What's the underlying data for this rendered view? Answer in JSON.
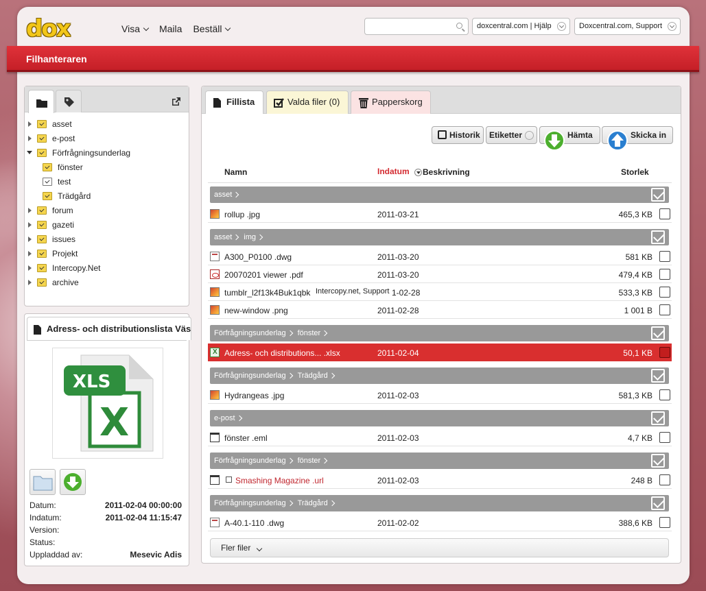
{
  "logo": "dox",
  "nav": {
    "visa": "Visa",
    "maila": "Maila",
    "bestall": "Beställ"
  },
  "search": {
    "placeholder": ""
  },
  "help_dropdown": "doxcentral.com | Hjälp",
  "account_dropdown": "Doxcentral.com, Support",
  "page_title": "Filhanteraren",
  "tree": [
    {
      "label": "asset",
      "level": 0,
      "expanded": false
    },
    {
      "label": "e-post",
      "level": 0,
      "expanded": false
    },
    {
      "label": "Förfrågningsunderlag",
      "level": 0,
      "expanded": true
    },
    {
      "label": "fönster",
      "level": 1
    },
    {
      "label": "test",
      "level": 1
    },
    {
      "label": "Trädgård",
      "level": 1
    },
    {
      "label": "forum",
      "level": 0,
      "expanded": false
    },
    {
      "label": "gazeti",
      "level": 0,
      "expanded": false
    },
    {
      "label": "issues",
      "level": 0,
      "expanded": false
    },
    {
      "label": "Projekt",
      "level": 0,
      "expanded": false
    },
    {
      "label": "Intercopy.Net",
      "level": 0,
      "expanded": false
    },
    {
      "label": "archive",
      "level": 0,
      "expanded": false
    }
  ],
  "preview": {
    "title": "Adress- och distributionslista Väst",
    "icon_text": "XLS",
    "labels": {
      "datum": "Datum:",
      "indatum": "Indatum:",
      "version": "Version:",
      "status": "Status:",
      "uppladdad": "Uppladdad av:"
    },
    "values": {
      "datum": "2011-02-04 00:00:00",
      "indatum": "2011-02-04 11:15:47",
      "version": "",
      "status": "",
      "uppladdad": "Mesevic Adis"
    }
  },
  "tabs": {
    "fillista": "Fillista",
    "valda": "Valda filer (0)",
    "papperskorg": "Papperskorg"
  },
  "buttons": {
    "historik": "Historik",
    "etiketter": "Etiketter",
    "hamta": "Hämta",
    "skicka": "Skicka in"
  },
  "columns": {
    "namn": "Namn",
    "indatum": "Indatum",
    "beskrivning": "Beskrivning",
    "storlek": "Storlek"
  },
  "groups": [
    {
      "path": [
        "asset"
      ]
    },
    {
      "path": [
        "asset",
        "img"
      ]
    },
    {
      "path": [
        "Förfrågningsunderlag",
        "fönster"
      ]
    },
    {
      "path": [
        "Förfrågningsunderlag",
        "Trädgård"
      ]
    },
    {
      "path": [
        "e-post"
      ]
    },
    {
      "path": [
        "Förfrågningsunderlag",
        "fönster"
      ]
    },
    {
      "path": [
        "Förfrågningsunderlag",
        "Trädgård"
      ]
    }
  ],
  "files": [
    {
      "name": "rollup .jpg",
      "date": "2011-03-21",
      "size": "465,3 KB",
      "icon": "image-icon"
    },
    {
      "name": "A300_P0100 .dwg",
      "date": "2011-03-20",
      "size": "581 KB",
      "icon": "drawing-icon"
    },
    {
      "name": "20070201 viewer .pdf",
      "date": "2011-03-20",
      "size": "479,4 KB",
      "icon": "pdf-icon"
    },
    {
      "name": "tumblr_l2f13k4Buk1qbk",
      "date": "1-02-28",
      "size": "533,3 KB",
      "icon": "image-icon",
      "tooltip": "Intercopy.net, Support"
    },
    {
      "name": "new-window .png",
      "date": "2011-02-28",
      "size": "1 001 B",
      "icon": "image-icon"
    },
    {
      "name": "Adress- och distributions... .xlsx",
      "date": "2011-02-04",
      "size": "50,1 KB",
      "icon": "excel-icon",
      "selected": true
    },
    {
      "name": "Hydrangeas .jpg",
      "date": "2011-02-03",
      "size": "581,3 KB",
      "icon": "image-icon"
    },
    {
      "name": "fönster .eml",
      "date": "2011-02-03",
      "size": "4,7 KB",
      "icon": "email-icon"
    },
    {
      "name": "Smashing Magazine .url",
      "date": "2011-02-03",
      "size": "248 B",
      "icon": "link-icon",
      "link": true
    },
    {
      "name": "A-40.1-110 .dwg",
      "date": "2011-02-02",
      "size": "388,6 KB",
      "icon": "drawing-icon"
    }
  ],
  "more_files": "Fler filer",
  "colors": {
    "accent_red": "#d32a30",
    "link_red": "#c0262e",
    "group_gray": "#999999"
  }
}
